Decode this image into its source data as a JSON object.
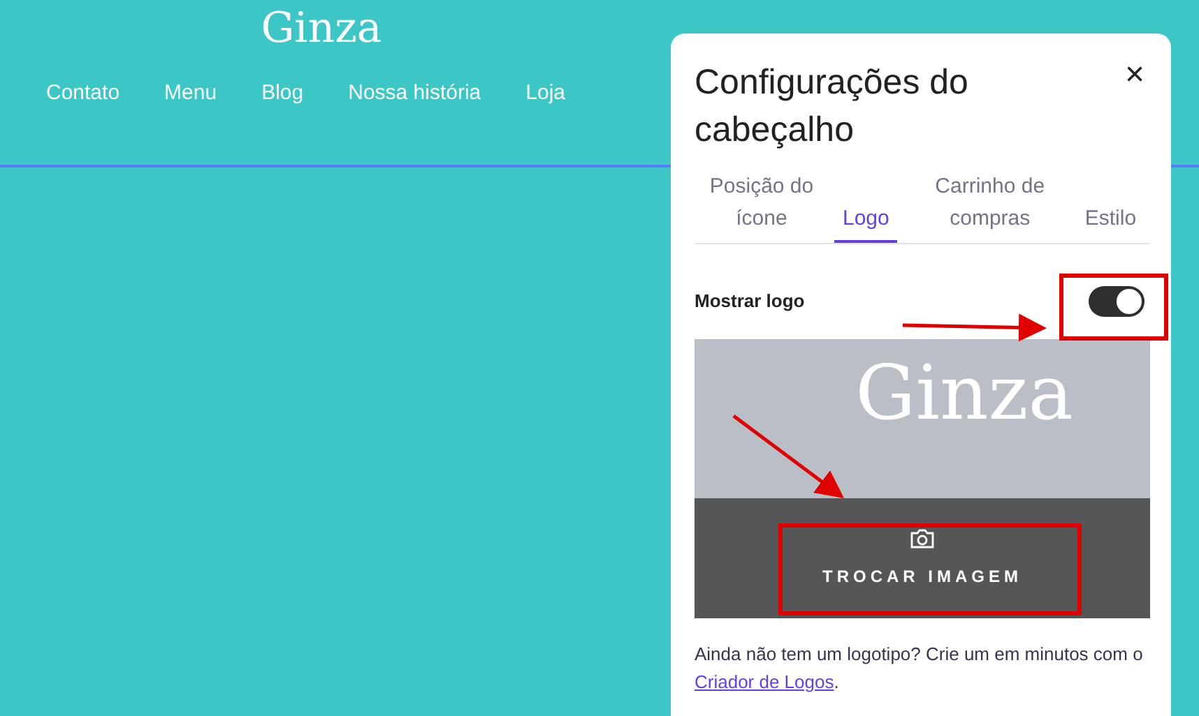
{
  "site": {
    "logo": "Ginza",
    "nav": [
      "Contato",
      "Menu",
      "Blog",
      "Nossa história",
      "Loja"
    ]
  },
  "panel": {
    "title": "Configurações do cabeçalho",
    "close": "×",
    "tabs": [
      {
        "label": "Posição do ícone",
        "selected": false
      },
      {
        "label": "Logo",
        "selected": true
      },
      {
        "label": "Carrinho de compras",
        "selected": false
      },
      {
        "label": "Estilo",
        "selected": false
      }
    ],
    "show_logo": {
      "label": "Mostrar logo",
      "on": true
    },
    "preview": {
      "logo": "Ginza",
      "button": "TROCAR IMAGEM"
    },
    "hint": {
      "text": "Ainda não tem um logotipo? Crie um em minutos com o ",
      "link": "Criador de Logos",
      "end": "."
    }
  }
}
